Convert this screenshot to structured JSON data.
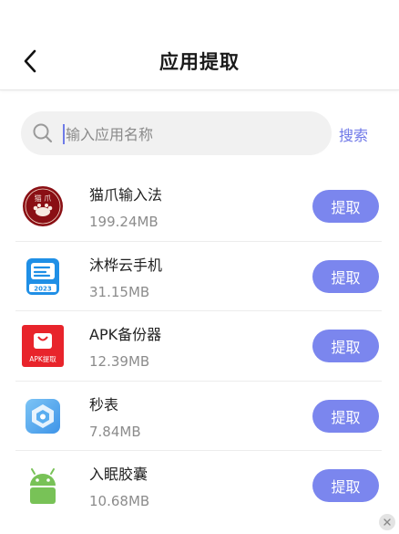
{
  "header": {
    "title": "应用提取"
  },
  "search": {
    "placeholder": "输入应用名称",
    "button_label": "搜索"
  },
  "apps": [
    {
      "name": "猫爪输入法",
      "size": "199.24MB",
      "action": "提取",
      "icon": "maozhua-app-icon"
    },
    {
      "name": "沐桦云手机",
      "size": "31.15MB",
      "action": "提取",
      "icon": "muhua-cloud-phone-icon"
    },
    {
      "name": "APK备份器",
      "size": "12.39MB",
      "action": "提取",
      "icon": "apk-backup-icon"
    },
    {
      "name": "秒表",
      "size": "7.84MB",
      "action": "提取",
      "icon": "stopwatch-app-icon"
    },
    {
      "name": "入眠胶囊",
      "size": "10.68MB",
      "action": "提取",
      "icon": "android-icon"
    }
  ],
  "icon_text": {
    "maozhua_top": "猫 爪",
    "apk": "APK提取",
    "year": "2023"
  },
  "colors": {
    "accent": "#7b86ee",
    "link": "#6f78e8"
  }
}
